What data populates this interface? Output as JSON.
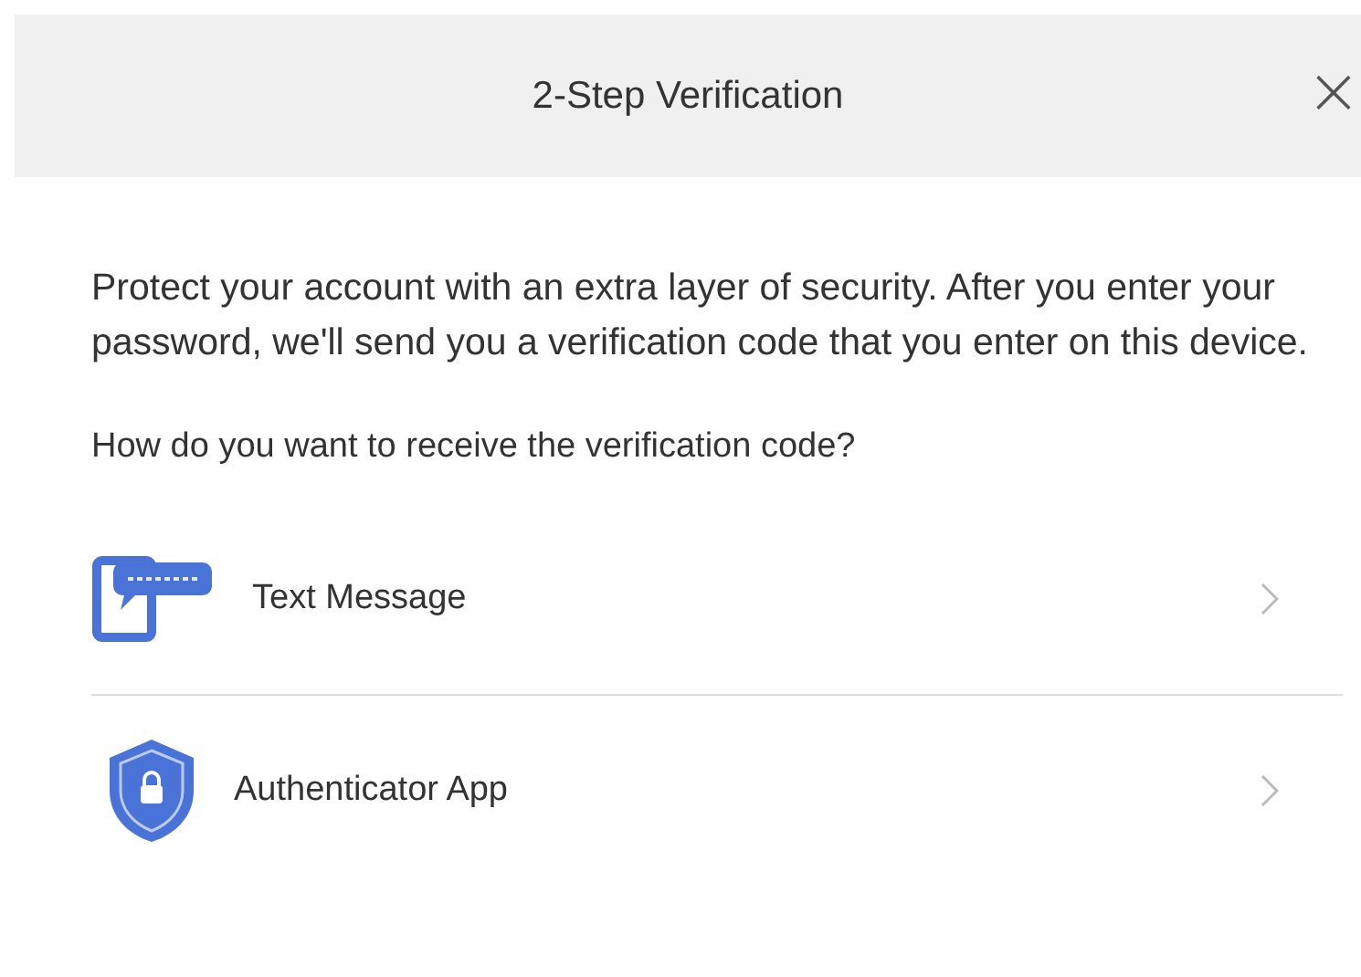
{
  "dialog": {
    "title": "2-Step Verification",
    "close": "×"
  },
  "intro": "Protect your account with an extra layer of security. After you enter your password, we'll send you a verification code that you enter on this device.",
  "question": "How do you want to receive the verification code?",
  "options": [
    {
      "kind": "sms",
      "label": "Text Message"
    },
    {
      "kind": "authenticator",
      "label": "Authenticator App"
    }
  ]
}
